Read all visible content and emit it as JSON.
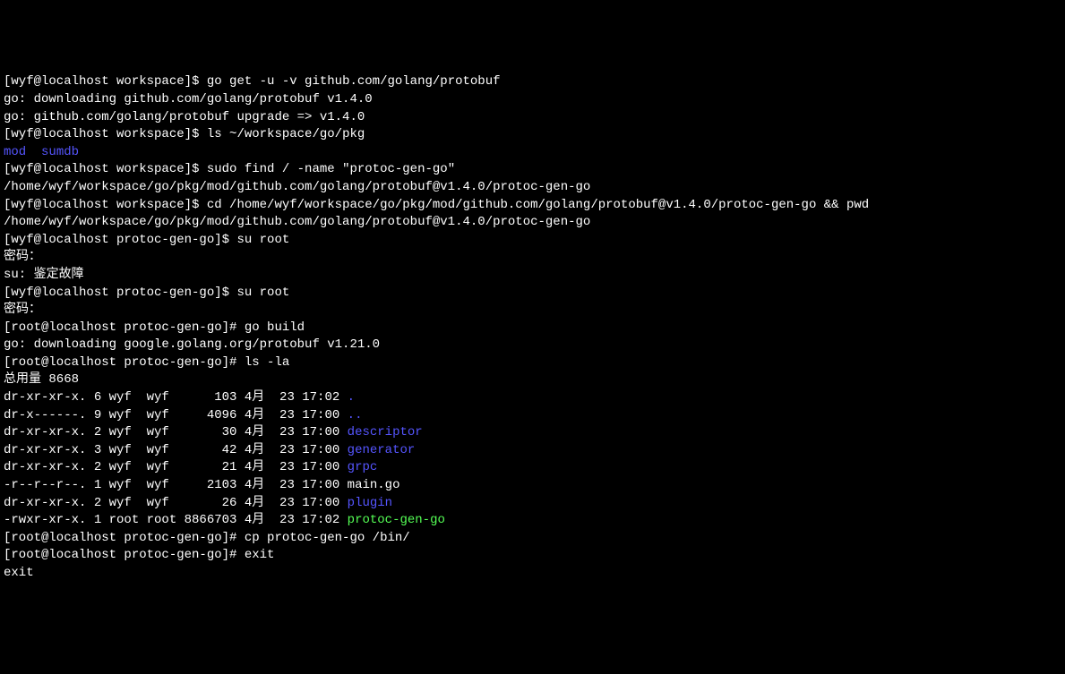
{
  "lines": [
    {
      "prompt": "[wyf@localhost workspace]$ ",
      "cmd": "go get -u -v github.com/golang/protobuf"
    },
    {
      "text": "go: downloading github.com/golang/protobuf v1.4.0"
    },
    {
      "text": "go: github.com/golang/protobuf upgrade => v1.4.0"
    },
    {
      "prompt": "[wyf@localhost workspace]$ ",
      "cmd": "ls ~/workspace/go/pkg"
    },
    {
      "blue1": "mod",
      "sep": "  ",
      "blue2": "sumdb"
    },
    {
      "prompt": "[wyf@localhost workspace]$ ",
      "cmd": "sudo find / -name \"protoc-gen-go\""
    },
    {
      "text": "/home/wyf/workspace/go/pkg/mod/github.com/golang/protobuf@v1.4.0/protoc-gen-go"
    },
    {
      "prompt": "[wyf@localhost workspace]$ ",
      "cmd": "cd /home/wyf/workspace/go/pkg/mod/github.com/golang/protobuf@v1.4.0/protoc-gen-go && pwd"
    },
    {
      "text": "/home/wyf/workspace/go/pkg/mod/github.com/golang/protobuf@v1.4.0/protoc-gen-go"
    },
    {
      "prompt": "[wyf@localhost protoc-gen-go]$ ",
      "cmd": "su root"
    },
    {
      "text": "密码："
    },
    {
      "text": "su: 鉴定故障"
    },
    {
      "prompt": "[wyf@localhost protoc-gen-go]$ ",
      "cmd": "su root"
    },
    {
      "text": "密码："
    },
    {
      "prompt": "[root@localhost protoc-gen-go]# ",
      "cmd": "go build"
    },
    {
      "text": "go: downloading google.golang.org/protobuf v1.21.0"
    },
    {
      "prompt": "[root@localhost protoc-gen-go]# ",
      "cmd": "ls -la"
    },
    {
      "text": "总用量 8668"
    },
    {
      "perms": "dr-xr-xr-x. 6 wyf  wyf      103 4月  23 17:02 ",
      "name": ".",
      "color": "blue"
    },
    {
      "perms": "dr-x------. 9 wyf  wyf     4096 4月  23 17:00 ",
      "name": "..",
      "color": "blue"
    },
    {
      "perms": "dr-xr-xr-x. 2 wyf  wyf       30 4月  23 17:00 ",
      "name": "descriptor",
      "color": "blue"
    },
    {
      "perms": "dr-xr-xr-x. 3 wyf  wyf       42 4月  23 17:00 ",
      "name": "generator",
      "color": "blue"
    },
    {
      "perms": "dr-xr-xr-x. 2 wyf  wyf       21 4月  23 17:00 ",
      "name": "grpc",
      "color": "blue"
    },
    {
      "perms": "-r--r--r--. 1 wyf  wyf     2103 4月  23 17:00 ",
      "name": "main.go",
      "color": "white"
    },
    {
      "perms": "dr-xr-xr-x. 2 wyf  wyf       26 4月  23 17:00 ",
      "name": "plugin",
      "color": "blue"
    },
    {
      "perms": "-rwxr-xr-x. 1 root root 8866703 4月  23 17:02 ",
      "name": "protoc-gen-go",
      "color": "green"
    },
    {
      "prompt": "[root@localhost protoc-gen-go]# ",
      "cmd": "cp protoc-gen-go /bin/"
    },
    {
      "prompt": "[root@localhost protoc-gen-go]# ",
      "cmd": "exit"
    },
    {
      "text": "exit"
    }
  ]
}
